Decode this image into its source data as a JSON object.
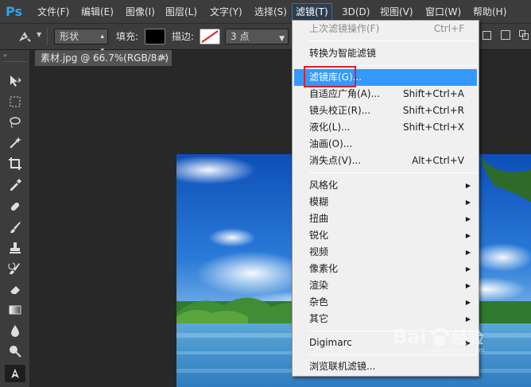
{
  "app": {
    "logo": "Ps"
  },
  "menubar": {
    "items": [
      {
        "label": "文件(F)"
      },
      {
        "label": "编辑(E)"
      },
      {
        "label": "图像(I)"
      },
      {
        "label": "图层(L)"
      },
      {
        "label": "文字(Y)"
      },
      {
        "label": "选择(S)"
      },
      {
        "label": "滤镜(T)"
      },
      {
        "label": "3D(D)"
      },
      {
        "label": "视图(V)"
      },
      {
        "label": "窗口(W)"
      },
      {
        "label": "帮助(H)"
      }
    ],
    "active": "滤镜(T)"
  },
  "options": {
    "mode_value": "形状",
    "fill_label": "填充:",
    "stroke_label": "描边:",
    "stroke_width": "3 点",
    "fill_color": "#000000"
  },
  "document": {
    "tab_title": "素材.jpg @ 66.7%(RGB/8#)",
    "close_glyph": "×"
  },
  "filter_menu": {
    "items": [
      {
        "label": "上次滤镜操作(F)",
        "shortcut": "Ctrl+F",
        "disabled": true
      },
      {
        "label": "转换为智能滤镜"
      },
      {
        "label": "滤镜库(G)...",
        "highlighted": true
      },
      {
        "label": "自适应广角(A)...",
        "shortcut": "Shift+Ctrl+A"
      },
      {
        "label": "镜头校正(R)...",
        "shortcut": "Shift+Ctrl+R"
      },
      {
        "label": "液化(L)...",
        "shortcut": "Shift+Ctrl+X"
      },
      {
        "label": "油画(O)..."
      },
      {
        "label": "消失点(V)...",
        "shortcut": "Alt+Ctrl+V"
      },
      {
        "label": "风格化",
        "submenu": true
      },
      {
        "label": "模糊",
        "submenu": true
      },
      {
        "label": "扭曲",
        "submenu": true
      },
      {
        "label": "锐化",
        "submenu": true
      },
      {
        "label": "视频",
        "submenu": true
      },
      {
        "label": "像素化",
        "submenu": true
      },
      {
        "label": "渲染",
        "submenu": true
      },
      {
        "label": "杂色",
        "submenu": true
      },
      {
        "label": "其它",
        "submenu": true
      },
      {
        "label": "Digimarc",
        "submenu": true
      },
      {
        "label": "浏览联机滤镜..."
      }
    ],
    "submenu_glyph": "▶"
  },
  "watermark": {
    "text": "Bai 经验",
    "sub": "jingyan.baidu.com"
  },
  "colors": {
    "accent": "#3399ff",
    "highlight_border": "#d8202a",
    "ps_blue": "#2fa3f1"
  }
}
